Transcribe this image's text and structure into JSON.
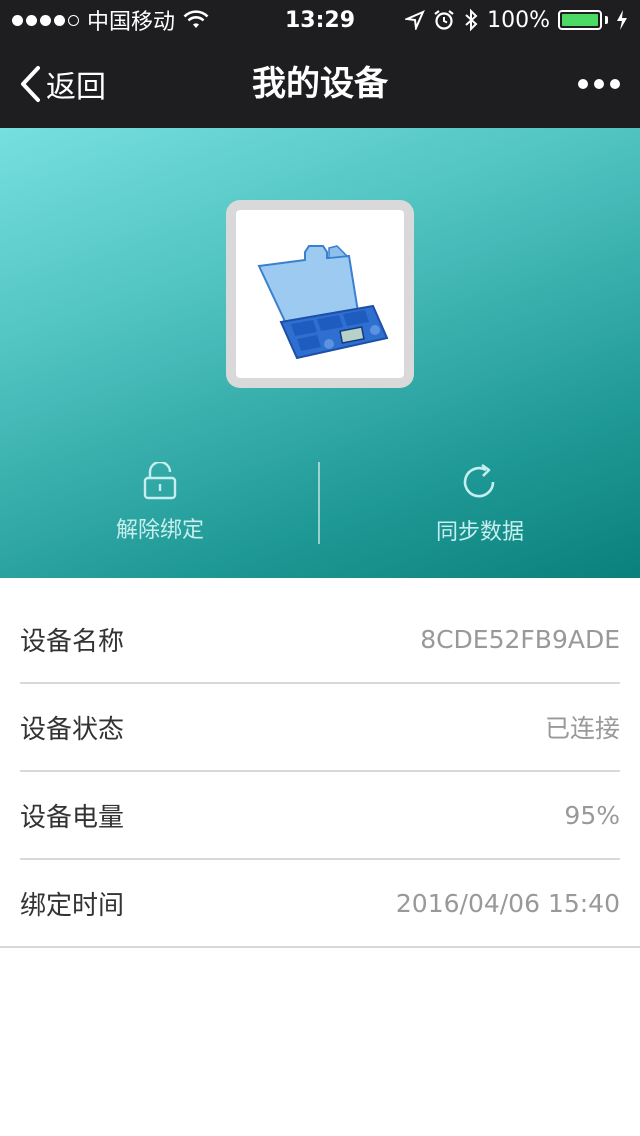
{
  "status_bar": {
    "carrier": "中国移动",
    "time": "13:29",
    "battery": "100%",
    "battery_level": 1.0,
    "battery_color": "#4cd964"
  },
  "nav": {
    "back_label": "返回",
    "title": "我的设备",
    "more_icon": "more-dots-icon"
  },
  "hero": {
    "gradient_start": "#76dfdf",
    "gradient_end": "#0b807b",
    "device_image": "blue-pill-box-image",
    "actions": [
      {
        "label": "解除绑定",
        "icon": "unlock-icon"
      },
      {
        "label": "同步数据",
        "icon": "refresh-icon"
      }
    ]
  },
  "info": [
    {
      "label": "设备名称",
      "value": "8CDE52FB9ADE"
    },
    {
      "label": "设备状态",
      "value": "已连接"
    },
    {
      "label": "设备电量",
      "value": "95%"
    },
    {
      "label": "绑定时间",
      "value": "2016/04/06 15:40"
    }
  ]
}
